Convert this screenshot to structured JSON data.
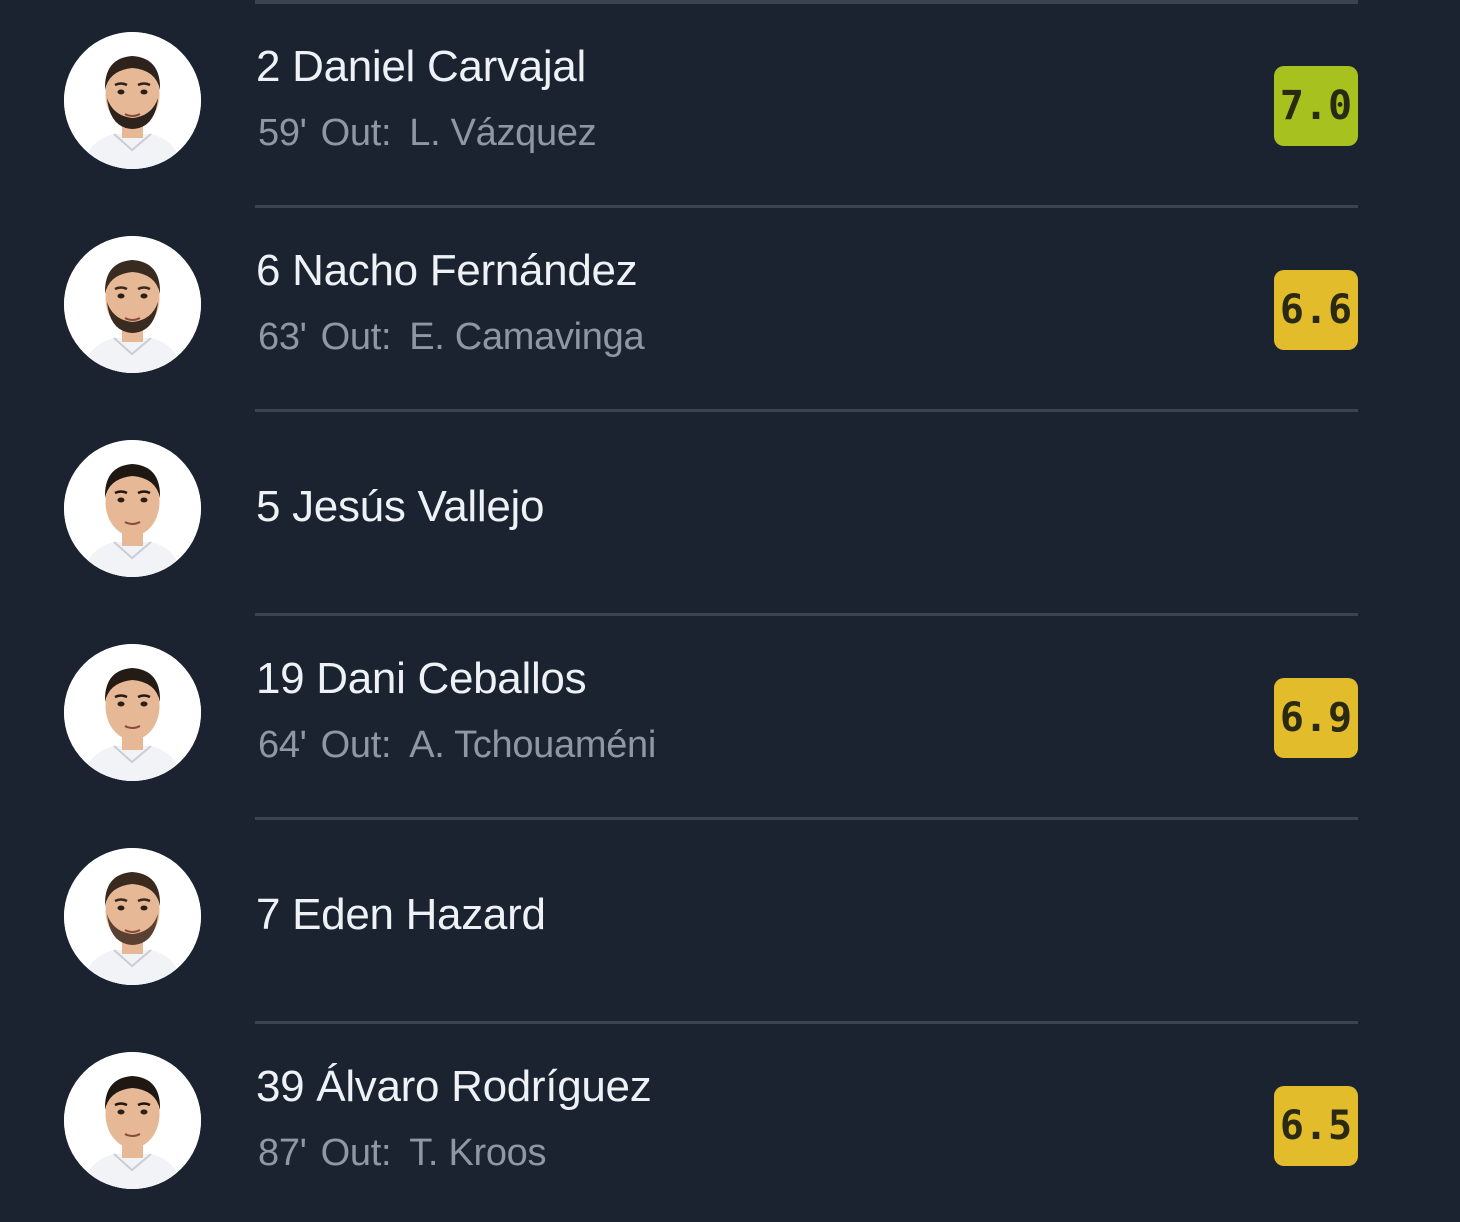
{
  "colors": {
    "background": "#1b2330",
    "divider": "#3a4352",
    "name_text": "#eef1f5",
    "sub_text": "#8e97a4",
    "swap_icon": "#3e8fe6",
    "rating_green": "#a7c21f",
    "rating_yellow": "#e2bc2b"
  },
  "players": [
    {
      "number_name": "2 Daniel Carvajal",
      "sub": {
        "icon": "swap-icon",
        "minute": "59'",
        "out_label": "Out:",
        "out_player": "L. Vázquez"
      },
      "rating": "7.0",
      "rating_color": "#a7c21f",
      "avatar_hair": "#2d231c",
      "avatar_beard": "#2d231c"
    },
    {
      "number_name": "6 Nacho Fernández",
      "sub": {
        "icon": "swap-icon",
        "minute": "63'",
        "out_label": "Out:",
        "out_player": "E. Camavinga"
      },
      "rating": "6.6",
      "rating_color": "#e2bc2b",
      "avatar_hair": "#3a2b20",
      "avatar_beard": "#3a2b20"
    },
    {
      "number_name": "5 Jesús Vallejo",
      "sub": null,
      "rating": null,
      "avatar_hair": "#1e1712",
      "avatar_beard": null
    },
    {
      "number_name": "19 Dani Ceballos",
      "sub": {
        "icon": "swap-icon",
        "minute": "64'",
        "out_label": "Out:",
        "out_player": "A. Tchouaméni"
      },
      "rating": "6.9",
      "rating_color": "#e2bc2b",
      "avatar_hair": "#241b15",
      "avatar_beard": null
    },
    {
      "number_name": "7 Eden Hazard",
      "sub": null,
      "rating": null,
      "avatar_hair": "#3a2a1e",
      "avatar_beard": "#5a4030"
    },
    {
      "number_name": "39 Álvaro Rodríguez",
      "sub": {
        "icon": "swap-icon",
        "minute": "87'",
        "out_label": "Out:",
        "out_player": "T. Kroos"
      },
      "rating": "6.5",
      "rating_color": "#e2bc2b",
      "avatar_hair": "#1e1712",
      "avatar_beard": null
    }
  ]
}
